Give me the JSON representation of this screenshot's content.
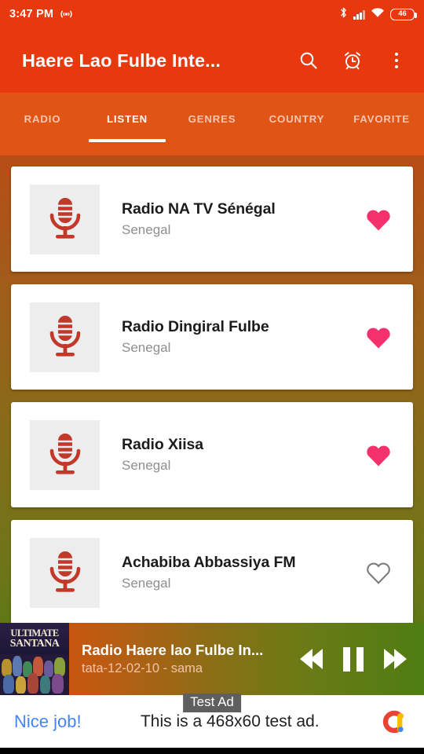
{
  "status_bar": {
    "time": "3:47 PM",
    "cast_icon": "broadcast-icon",
    "bluetooth_icon": "bluetooth-icon",
    "signal_icon": "cellular-signal-icon",
    "wifi_icon": "wifi-icon",
    "battery_level": "46"
  },
  "app_bar": {
    "title": "Haere Lao Fulbe Inte...",
    "search_icon": "search-icon",
    "alarm_icon": "alarm-clock-icon",
    "overflow_icon": "more-vertical-icon"
  },
  "tabs": {
    "items": [
      {
        "label": "RADIO",
        "active": false
      },
      {
        "label": "LISTEN",
        "active": true
      },
      {
        "label": "GENRES",
        "active": false
      },
      {
        "label": "COUNTRY",
        "active": false
      },
      {
        "label": "FAVORITE",
        "active": false
      }
    ]
  },
  "stations": [
    {
      "title": "Radio NA TV Sénégal",
      "country": "Senegal",
      "favorited": true
    },
    {
      "title": "Radio Dingiral Fulbe",
      "country": "Senegal",
      "favorited": true
    },
    {
      "title": "Radio Xiisa",
      "country": "Senegal",
      "favorited": true
    },
    {
      "title": "Achabiba Abbassiya FM",
      "country": "Senegal",
      "favorited": false
    }
  ],
  "player": {
    "album_art_line1": "ULTIMATE",
    "album_art_line2": "SANTANA",
    "title": "Radio Haere lao Fulbe In...",
    "subtitle": "tata-12-02-10 - sama",
    "rewind_icon": "rewind-icon",
    "pause_icon": "pause-icon",
    "forward_icon": "fast-forward-icon"
  },
  "ad": {
    "badge": "Test Ad",
    "cta": "Nice job!",
    "body": "This is a 468x60 test ad.",
    "logo_icon": "admob-logo-icon"
  },
  "colors": {
    "app_bar": "#e8380d",
    "tab_bar": "#e05415",
    "favorite_on": "#f4306d",
    "favorite_off": "#7c7c7c",
    "mic_icon": "#c0392b",
    "ad_cta": "#4285f4"
  }
}
